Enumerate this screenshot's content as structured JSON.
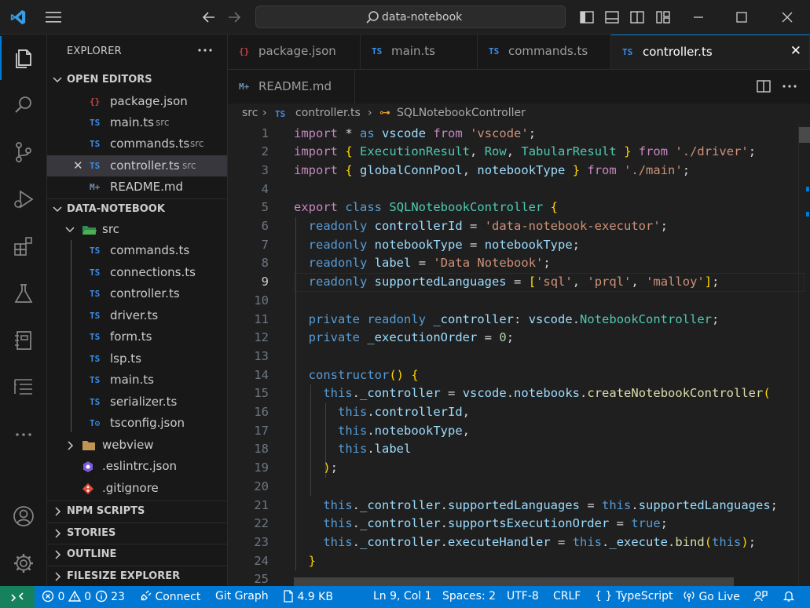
{
  "title_bar": {
    "search_text": "data-notebook"
  },
  "explorer": {
    "title": "EXPLORER",
    "open_editors": {
      "header": "OPEN EDITORS",
      "items": [
        {
          "icon": "json",
          "name": "package.json",
          "desc": ""
        },
        {
          "icon": "TS",
          "name": "main.ts",
          "desc": "src"
        },
        {
          "icon": "TS",
          "name": "commands.ts",
          "desc": "src"
        },
        {
          "icon": "TS",
          "name": "controller.ts",
          "desc": "src"
        },
        {
          "icon": "M+",
          "name": "README.md",
          "desc": ""
        }
      ]
    },
    "project": {
      "header": "DATA-NOTEBOOK",
      "folder": "src",
      "files": [
        "commands.ts",
        "connections.ts",
        "controller.ts",
        "driver.ts",
        "form.ts",
        "lsp.ts",
        "main.ts",
        "serializer.ts",
        "tsconfig.json"
      ],
      "other": [
        "webview",
        ".eslintrc.json",
        ".gitignore"
      ]
    },
    "collapsed_sections": [
      "NPM SCRIPTS",
      "STORIES",
      "OUTLINE",
      "FILESIZE EXPLORER"
    ]
  },
  "tabs": [
    {
      "icon": "json",
      "label": "package.json"
    },
    {
      "icon": "TS",
      "label": "main.ts"
    },
    {
      "icon": "TS",
      "label": "commands.ts"
    },
    {
      "icon": "TS",
      "label": "controller.ts",
      "active": true
    },
    {
      "icon": "M+",
      "label": "README.md"
    }
  ],
  "breadcrumb": {
    "folder": "src",
    "file": "controller.ts",
    "symbol": "SQLNotebookController"
  },
  "code": {
    "current_line": 9,
    "line_numbers": [
      "1",
      "2",
      "3",
      "4",
      "5",
      "6",
      "7",
      "8",
      "9",
      "10",
      "11",
      "12",
      "13",
      "14",
      "15",
      "16",
      "17",
      "18",
      "19",
      "20",
      "21",
      "22",
      "23",
      "24",
      "25"
    ],
    "lines": [
      "import * as vscode from 'vscode';",
      "import { ExecutionResult, Row, TabularResult } from './driver';",
      "import { globalConnPool, notebookType } from './main';",
      "",
      "export class SQLNotebookController {",
      "  readonly controllerId = 'data-notebook-executor';",
      "  readonly notebookType = notebookType;",
      "  readonly label = 'Data Notebook';",
      "  readonly supportedLanguages = ['sql', 'prql', 'malloy'];",
      "",
      "  private readonly _controller: vscode.NotebookController;",
      "  private _executionOrder = 0;",
      "",
      "  constructor() {",
      "    this._controller = vscode.notebooks.createNotebookController(",
      "      this.controllerId,",
      "      this.notebookType,",
      "      this.label",
      "    );",
      "",
      "    this._controller.supportedLanguages = this.supportedLanguages;",
      "    this._controller.supportsExecutionOrder = true;",
      "    this._controller.executeHandler = this._execute.bind(this);",
      "  }",
      ""
    ]
  },
  "status_bar": {
    "errors": "0",
    "warnings": "0",
    "info": "23",
    "connect": "Connect",
    "git_graph": "Git Graph",
    "file_size": "4.9 KB",
    "position": "Ln 9, Col 1",
    "spaces": "Spaces: 2",
    "encoding": "UTF-8",
    "eol": "CRLF",
    "language": "TypeScript",
    "go_live": "Go Live"
  },
  "colors": {
    "accent": "#0078d4",
    "remote": "#16825d",
    "ts_icon": "#3b8eea",
    "json_icon": "#cb4242"
  }
}
